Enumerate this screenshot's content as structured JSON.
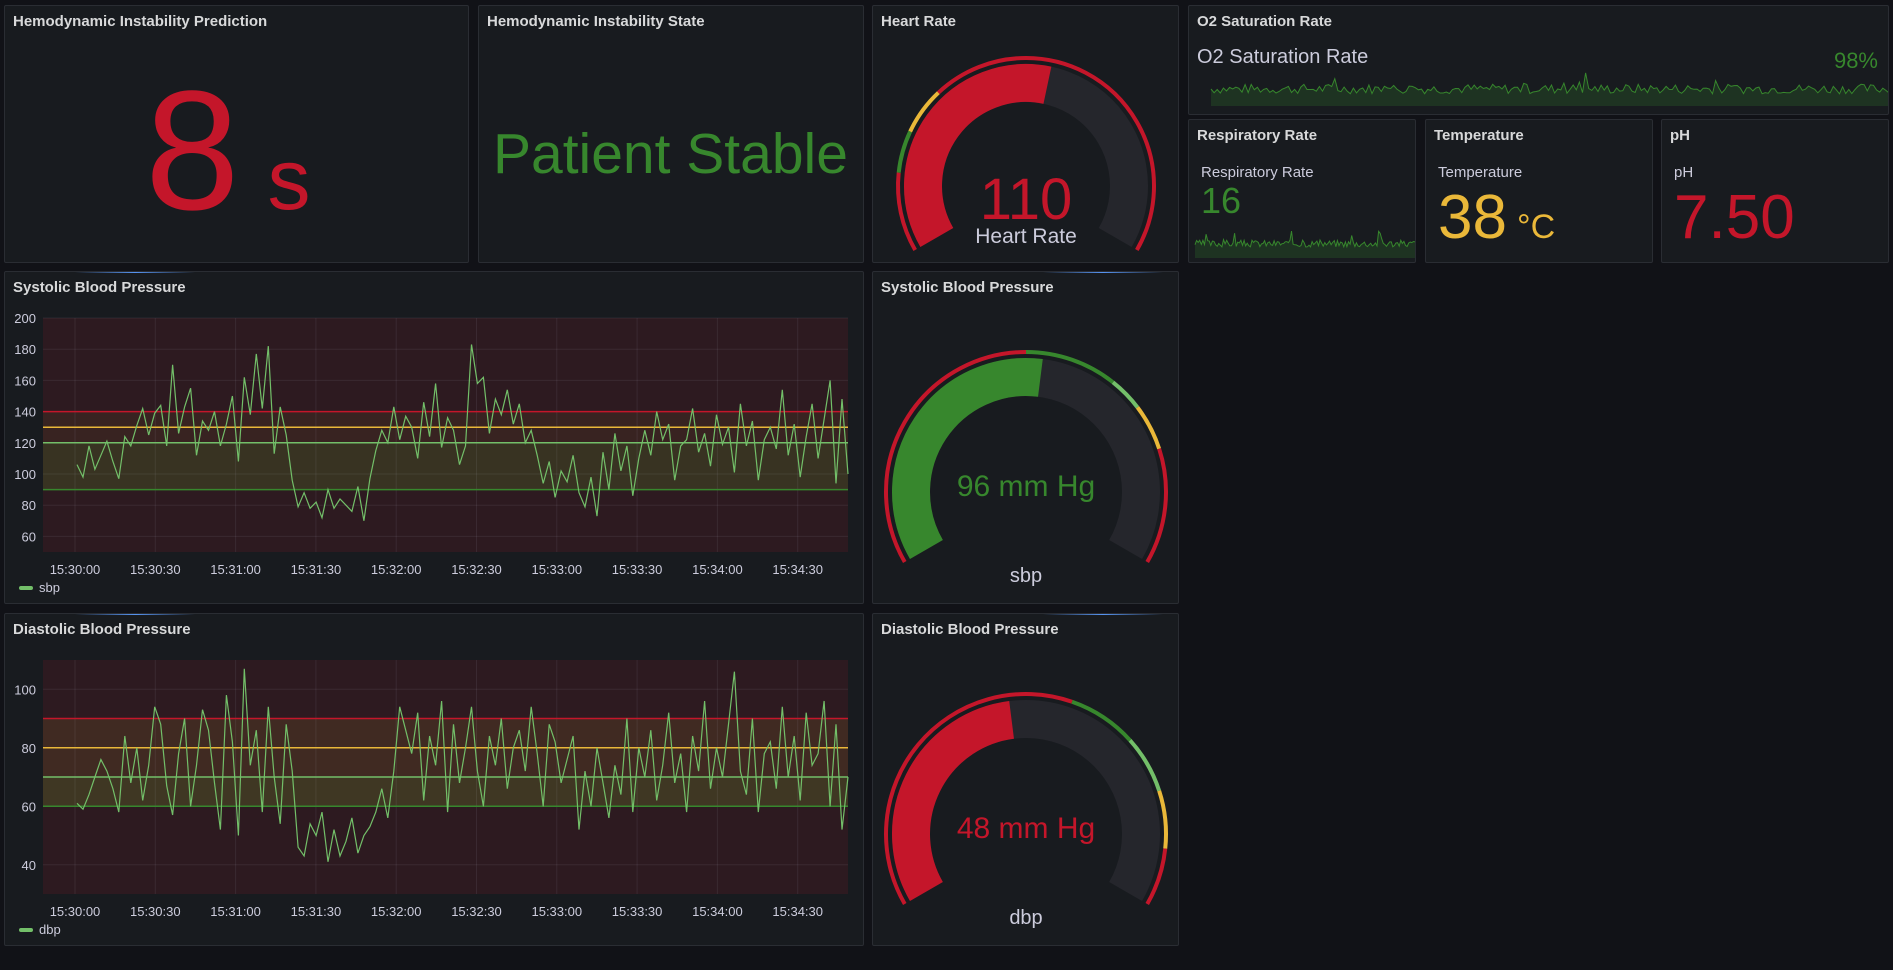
{
  "colors": {
    "green": "#37872d",
    "bright_green": "#73bf69",
    "red": "#c4162a",
    "yellow": "#eab839",
    "orange": "#ff9830",
    "track": "#25262c"
  },
  "prediction": {
    "title": "Hemodynamic Instability Prediction",
    "value": "8",
    "unit": "s"
  },
  "state": {
    "title": "Hemodynamic Instability State",
    "value": "Patient Stable"
  },
  "heart_rate": {
    "title": "Heart Rate",
    "value": "110",
    "label": "Heart Rate",
    "gauge_fraction": 0.55
  },
  "o2": {
    "title": "O2 Saturation Rate",
    "inner_title": "O2 Saturation Rate",
    "value": "98%"
  },
  "resp": {
    "title": "Respiratory Rate",
    "inner_title": "Respiratory Rate",
    "value": "16"
  },
  "temp": {
    "title": "Temperature",
    "inner_title": "Temperature",
    "value": "38",
    "unit": "°C"
  },
  "ph": {
    "title": "pH",
    "inner_title": "pH",
    "value": "7.50"
  },
  "sbp_chart": {
    "title": "Systolic Blood Pressure",
    "legend": "sbp",
    "yticks": [
      "200",
      "180",
      "160",
      "140",
      "120",
      "100",
      "80",
      "60"
    ],
    "xticks": [
      "15:30:00",
      "15:30:30",
      "15:31:00",
      "15:31:30",
      "15:32:00",
      "15:32:30",
      "15:33:00",
      "15:33:30",
      "15:34:00",
      "15:34:30"
    ]
  },
  "sbp_gauge": {
    "title": "Systolic Blood Pressure",
    "value": "96 mm Hg",
    "label": "sbp",
    "gauge_fraction": 0.53
  },
  "dbp_chart": {
    "title": "Diastolic Blood Pressure",
    "legend": "dbp",
    "yticks": [
      "100",
      "80",
      "60",
      "40"
    ],
    "xticks": [
      "15:30:00",
      "15:30:30",
      "15:31:00",
      "15:31:30",
      "15:32:00",
      "15:32:30",
      "15:33:00",
      "15:33:30",
      "15:34:00",
      "15:34:30"
    ]
  },
  "dbp_gauge": {
    "title": "Diastolic Blood Pressure",
    "value": "48 mm Hg",
    "label": "dbp",
    "gauge_fraction": 0.47
  },
  "chart_data": [
    {
      "type": "line",
      "title": "Systolic Blood Pressure",
      "series": [
        {
          "name": "sbp",
          "values": [
            106,
            98,
            118,
            103,
            112,
            121,
            108,
            97,
            124,
            118,
            131,
            142,
            125,
            139,
            144,
            118,
            170,
            126,
            143,
            155,
            112,
            134,
            128,
            140,
            118,
            132,
            150,
            108,
            162,
            138,
            177,
            142,
            182,
            113,
            143,
            125,
            96,
            79,
            88,
            78,
            82,
            72,
            90,
            78,
            84,
            80,
            76,
            92,
            70,
            97,
            115,
            128,
            120,
            143,
            122,
            137,
            130,
            110,
            146,
            124,
            158,
            117,
            136,
            128,
            106,
            118,
            183,
            158,
            162,
            126,
            148,
            138,
            154,
            132,
            145,
            120,
            128,
            112,
            94,
            108,
            85,
            102,
            95,
            112,
            88,
            79,
            98,
            73,
            114,
            90,
            126,
            102,
            118,
            86,
            110,
            128,
            112,
            140,
            122,
            132,
            96,
            118,
            122,
            142,
            114,
            126,
            105,
            138,
            119,
            130,
            101,
            145,
            118,
            134,
            96,
            122,
            130,
            116,
            154,
            112,
            132,
            98,
            124,
            145,
            110,
            135,
            160,
            94,
            148,
            100
          ]
        }
      ],
      "ylim": [
        50,
        200
      ]
    },
    {
      "type": "line",
      "title": "Diastolic Blood Pressure",
      "series": [
        {
          "name": "dbp",
          "values": [
            61,
            59,
            64,
            70,
            76,
            72,
            66,
            58,
            84,
            68,
            80,
            62,
            74,
            94,
            88,
            67,
            57,
            78,
            90,
            60,
            74,
            93,
            86,
            68,
            52,
            98,
            82,
            50,
            107,
            74,
            86,
            58,
            94,
            70,
            54,
            88,
            72,
            46,
            43,
            54,
            50,
            58,
            41,
            52,
            43,
            48,
            56,
            44,
            50,
            53,
            58,
            66,
            56,
            72,
            94,
            86,
            78,
            92,
            62,
            84,
            74,
            96,
            58,
            88,
            68,
            80,
            94,
            72,
            60,
            84,
            74,
            90,
            66,
            80,
            86,
            72,
            94,
            78,
            60,
            88,
            82,
            68,
            76,
            84,
            52,
            72,
            60,
            80,
            68,
            56,
            74,
            64,
            90,
            58,
            80,
            70,
            86,
            62,
            74,
            92,
            68,
            78,
            58,
            84,
            72,
            96,
            66,
            80,
            70,
            88,
            106,
            72,
            64,
            90,
            58,
            78,
            82,
            66,
            94,
            70,
            84,
            62,
            92,
            74,
            78,
            96,
            60,
            88,
            52,
            70
          ]
        }
      ],
      "ylim": [
        30,
        110
      ]
    }
  ]
}
